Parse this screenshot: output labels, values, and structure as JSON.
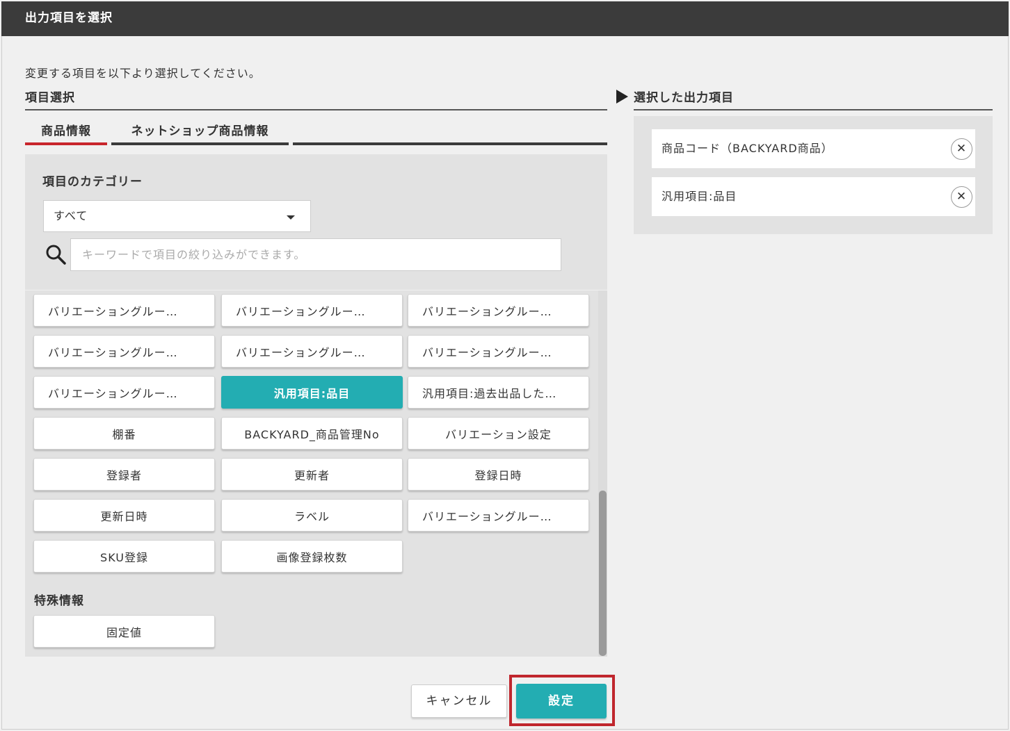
{
  "dialog": {
    "title": "出力項目を選択",
    "instruction": "変更する項目を以下より選択してください。"
  },
  "left": {
    "heading": "項目選択",
    "tabs": [
      {
        "label": "商品情報",
        "active": true
      },
      {
        "label": "ネットショップ商品情報",
        "active": false
      }
    ],
    "category_label": "項目のカテゴリー",
    "category_select": {
      "value": "すべて"
    },
    "search": {
      "placeholder": "キーワードで項目の絞り込みができます。",
      "value": ""
    },
    "items": [
      "バリエーショングルー…",
      "バリエーショングルー…",
      "バリエーショングルー…",
      "バリエーショングルー…",
      "バリエーショングルー…",
      "バリエーショングルー…",
      "バリエーショングルー…",
      "汎用項目:品目",
      "汎用項目:過去出品した…",
      "棚番",
      "BACKYARD_商品管理No",
      "バリエーション設定",
      "登録者",
      "更新者",
      "登録日時",
      "更新日時",
      "ラベル",
      "バリエーショングルー…",
      "SKU登録",
      "画像登録枚数"
    ],
    "selected_item": "汎用項目:品目",
    "special_label": "特殊情報",
    "special_items": [
      "固定値"
    ]
  },
  "right": {
    "heading": "選択した出力項目",
    "selected": [
      {
        "label": "商品コード（BACKYARD商品）",
        "remove_symbol": "✕"
      },
      {
        "label": "汎用項目:品目",
        "remove_symbol": "✕"
      }
    ]
  },
  "footer": {
    "cancel_label": "キャンセル",
    "ok_label": "設定"
  },
  "colors": {
    "accent": "#23adb2",
    "tab_active": "#c8252c",
    "titlebar": "#3b3b3b",
    "highlight": "#c0262d"
  }
}
